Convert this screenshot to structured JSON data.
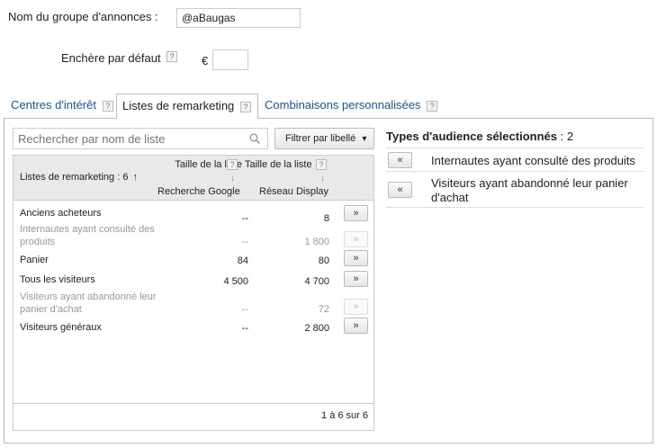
{
  "ad_group": {
    "name_label": "Nom du groupe d'annonces :",
    "name_value": "@aBaugas",
    "bid_label": "Enchère par défaut",
    "currency": "€",
    "bid_value": ""
  },
  "help_glyph": "?",
  "tabs": [
    {
      "label": "Centres d'intérêt"
    },
    {
      "label": "Listes de remarketing"
    },
    {
      "label": "Combinaisons personnalisées"
    }
  ],
  "search": {
    "placeholder": "Rechercher par nom de liste",
    "icon": "search-icon"
  },
  "filter": {
    "label": "Filtrer par libellé",
    "arrow": "▾"
  },
  "table": {
    "col_name": "Listes de remarketing : 6",
    "sort_arrow": "🡡",
    "col_google_top": "Taille de la liste",
    "col_google_bottom": "Recherche Google",
    "col_display_top": "Taille de la liste",
    "col_display_bottom": "Réseau Display",
    "sort_down": "↓",
    "add_glyph": "»",
    "rows": [
      {
        "name": "Anciens acheteurs",
        "google": "--",
        "display": "8",
        "disabled": false
      },
      {
        "name": "Internautes ayant consulté des produits",
        "google": "--",
        "display": "1 800",
        "disabled": true
      },
      {
        "name": "Panier",
        "google": "84",
        "display": "80",
        "disabled": false
      },
      {
        "name": "Tous les visiteurs",
        "google": "4 500",
        "display": "4 700",
        "disabled": false
      },
      {
        "name": "Visiteurs ayant abandonné leur panier d'achat",
        "google": "--",
        "display": "72",
        "disabled": true
      },
      {
        "name": "Visiteurs généraux",
        "google": "--",
        "display": "2 800",
        "disabled": false
      }
    ],
    "pagination": "1 à 6 sur 6"
  },
  "selected": {
    "title": "Types d'audience sélectionnés",
    "count": ": 2",
    "remove_glyph": "«",
    "items": [
      {
        "label": "Internautes ayant consulté des produits"
      },
      {
        "label": "Visiteurs ayant abandonné leur panier d'achat"
      }
    ]
  }
}
